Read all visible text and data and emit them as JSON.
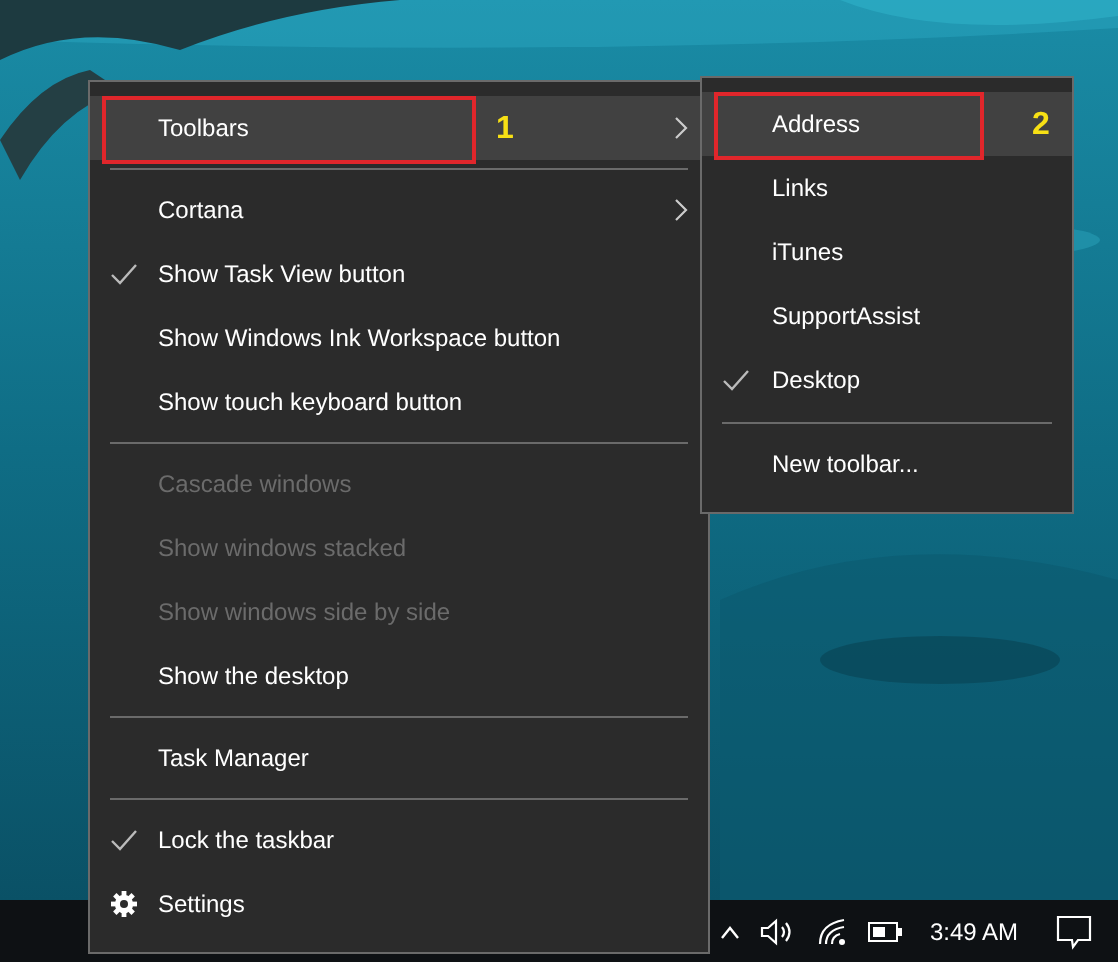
{
  "context_menu": {
    "items": [
      {
        "kind": "item",
        "label": "Toolbars",
        "submenu": true,
        "highlighted": true,
        "checked": false,
        "disabled": false,
        "callout": "1"
      },
      {
        "kind": "separator"
      },
      {
        "kind": "item",
        "label": "Cortana",
        "submenu": true,
        "highlighted": false,
        "checked": false,
        "disabled": false
      },
      {
        "kind": "item",
        "label": "Show Task View button",
        "submenu": false,
        "highlighted": false,
        "checked": true,
        "disabled": false
      },
      {
        "kind": "item",
        "label": "Show Windows Ink Workspace button",
        "submenu": false,
        "highlighted": false,
        "checked": false,
        "disabled": false
      },
      {
        "kind": "item",
        "label": "Show touch keyboard button",
        "submenu": false,
        "highlighted": false,
        "checked": false,
        "disabled": false
      },
      {
        "kind": "separator"
      },
      {
        "kind": "item",
        "label": "Cascade windows",
        "submenu": false,
        "highlighted": false,
        "checked": false,
        "disabled": true
      },
      {
        "kind": "item",
        "label": "Show windows stacked",
        "submenu": false,
        "highlighted": false,
        "checked": false,
        "disabled": true
      },
      {
        "kind": "item",
        "label": "Show windows side by side",
        "submenu": false,
        "highlighted": false,
        "checked": false,
        "disabled": true
      },
      {
        "kind": "item",
        "label": "Show the desktop",
        "submenu": false,
        "highlighted": false,
        "checked": false,
        "disabled": false
      },
      {
        "kind": "separator"
      },
      {
        "kind": "item",
        "label": "Task Manager",
        "submenu": false,
        "highlighted": false,
        "checked": false,
        "disabled": false
      },
      {
        "kind": "separator"
      },
      {
        "kind": "item",
        "label": "Lock the taskbar",
        "submenu": false,
        "highlighted": false,
        "checked": true,
        "disabled": false
      },
      {
        "kind": "settings",
        "label": "Settings",
        "submenu": false,
        "highlighted": false,
        "checked": false,
        "disabled": false
      }
    ]
  },
  "submenu": {
    "items": [
      {
        "kind": "item",
        "label": "Address",
        "highlighted": true,
        "checked": false,
        "callout": "2"
      },
      {
        "kind": "item",
        "label": "Links",
        "highlighted": false,
        "checked": false
      },
      {
        "kind": "item",
        "label": "iTunes",
        "highlighted": false,
        "checked": false
      },
      {
        "kind": "item",
        "label": "SupportAssist",
        "highlighted": false,
        "checked": false
      },
      {
        "kind": "item",
        "label": "Desktop",
        "highlighted": false,
        "checked": true
      },
      {
        "kind": "separator"
      },
      {
        "kind": "item",
        "label": "New toolbar...",
        "highlighted": false,
        "checked": false
      }
    ]
  },
  "taskbar": {
    "time": "3:49 AM"
  }
}
